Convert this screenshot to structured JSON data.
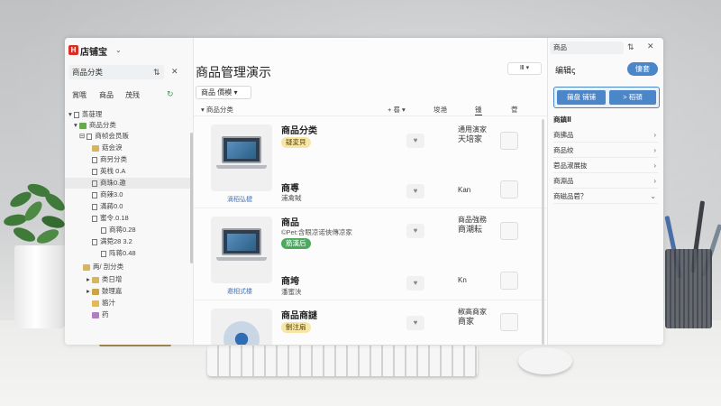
{
  "app": {
    "logo_text": "H",
    "title": "店铺宝"
  },
  "left": {
    "search_value": "商品分类",
    "tabs": [
      "賞哦",
      "商品",
      "茂残"
    ],
    "tree": [
      {
        "label": "蒸蓰理",
        "expanded": true
      },
      {
        "label": "商品分类",
        "expanded": true
      },
      {
        "label": "商帧会员贩"
      },
      {
        "label": "菇会淚"
      },
      {
        "label": "商另分类"
      },
      {
        "label": "英栈 0.A"
      },
      {
        "label": "商珠0.邀"
      },
      {
        "label": "商辣3.0"
      },
      {
        "label": "滿蔣0.0"
      },
      {
        "label": "蜜令.0.18"
      },
      {
        "label": "商蒋0.28"
      },
      {
        "label": "满菀28 3.2"
      },
      {
        "label": "阵蒋0.48"
      },
      {
        "label": "两/ 剖分类"
      },
      {
        "label": "类日增"
      },
      {
        "label": "鼓理嘉"
      },
      {
        "label": "貉汁"
      },
      {
        "label": "药"
      }
    ]
  },
  "main": {
    "title": "商品管理演示",
    "view_button": "Ⅲ ▾",
    "seg_label": "商品  價模  ▾",
    "header": {
      "col1": "商品分类",
      "col2": "+ 晷  ▾",
      "col3": "埈滟",
      "col4": "锺",
      "col5": "菅"
    },
    "products": [
      {
        "name": "商品分类",
        "badge": "疑変貝",
        "badge_color": "yellow",
        "caption": "滴稻弘楗",
        "status": [
          "通用演家",
          "天培家"
        ],
        "thumb": "laptop"
      },
      {
        "name": "商尃",
        "sub": "浦禽賊",
        "status": [
          "Kan"
        ],
        "thumb": "none"
      },
      {
        "name": "商品",
        "sub": "©Pet:含眼凉诺俠傳凉家",
        "badge": "筋漢后",
        "badge_color": "green",
        "caption": "邀相式楼",
        "status": [
          "商品強務",
          "商潮耘"
        ],
        "thumb": "laptop"
      },
      {
        "name": "商垮",
        "sub": "潘蜜浃",
        "status": [
          "Kn"
        ],
        "thumb": "none"
      },
      {
        "name": "商品商謎",
        "badge": "劊注扇",
        "caption": "",
        "status": [
          "椒高商家",
          "商家"
        ],
        "thumb": "disc"
      }
    ]
  },
  "right": {
    "search_value": "商品",
    "title": "编辑ꞔ",
    "pill": "悽套",
    "btn1": "蒱盘 铺铺",
    "btn2": "> 稻頓",
    "section_head": "商鎮Ⅱ",
    "items": [
      "商拂品",
      "商品绞",
      "菪品淑展抜",
      "商淵品",
      "商磁品菪？"
    ]
  },
  "colors": {
    "accent": "#4a86c8",
    "logo": "#d93026",
    "badge_yellow": "#f6e6a8",
    "badge_green": "#4caa5f"
  }
}
